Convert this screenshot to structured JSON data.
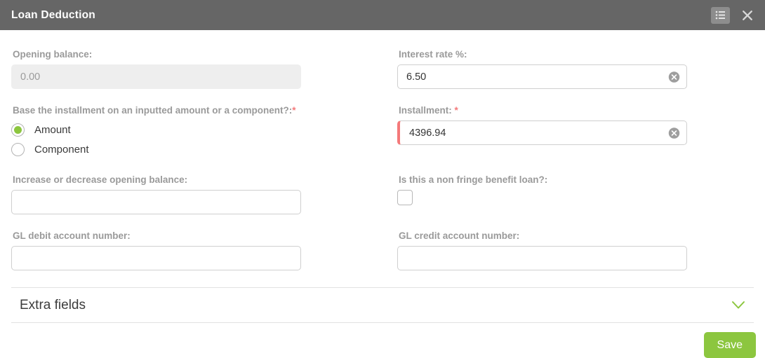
{
  "window": {
    "title": "Loan Deduction",
    "list_icon": "list-icon",
    "close_icon": "close-icon"
  },
  "theme": {
    "titlebar_bg": "#666666",
    "accent_green": "#8cc63f",
    "required_red": "#f4797a",
    "label_gray": "#9a9a9a",
    "border_gray": "#cfcfcf"
  },
  "form": {
    "opening_balance": {
      "label": "Opening balance:",
      "value": "0.00",
      "readonly": true
    },
    "interest_rate": {
      "label": "Interest rate %:",
      "value": "6.50",
      "clear_icon": "clear-circle-x-icon"
    },
    "base_question": {
      "label": "Base the installment on an inputted amount or a component?:",
      "required_marker": "*",
      "options": [
        {
          "label": "Amount",
          "selected": true
        },
        {
          "label": "Component",
          "selected": false
        }
      ]
    },
    "installment": {
      "label": "Installment:",
      "required_marker": "*",
      "value": "4396.94",
      "clear_icon": "clear-circle-x-icon"
    },
    "increase_decrease": {
      "label": "Increase or decrease opening balance:",
      "value": ""
    },
    "non_fringe": {
      "label": "Is this a non fringe benefit loan?:",
      "checked": false
    },
    "gl_debit": {
      "label": "GL debit account number:",
      "value": ""
    },
    "gl_credit": {
      "label": "GL credit account number:",
      "value": ""
    }
  },
  "extra_fields": {
    "title": "Extra fields",
    "chevron_icon": "chevron-down-icon",
    "expanded": false
  },
  "footer": {
    "save_label": "Save"
  }
}
